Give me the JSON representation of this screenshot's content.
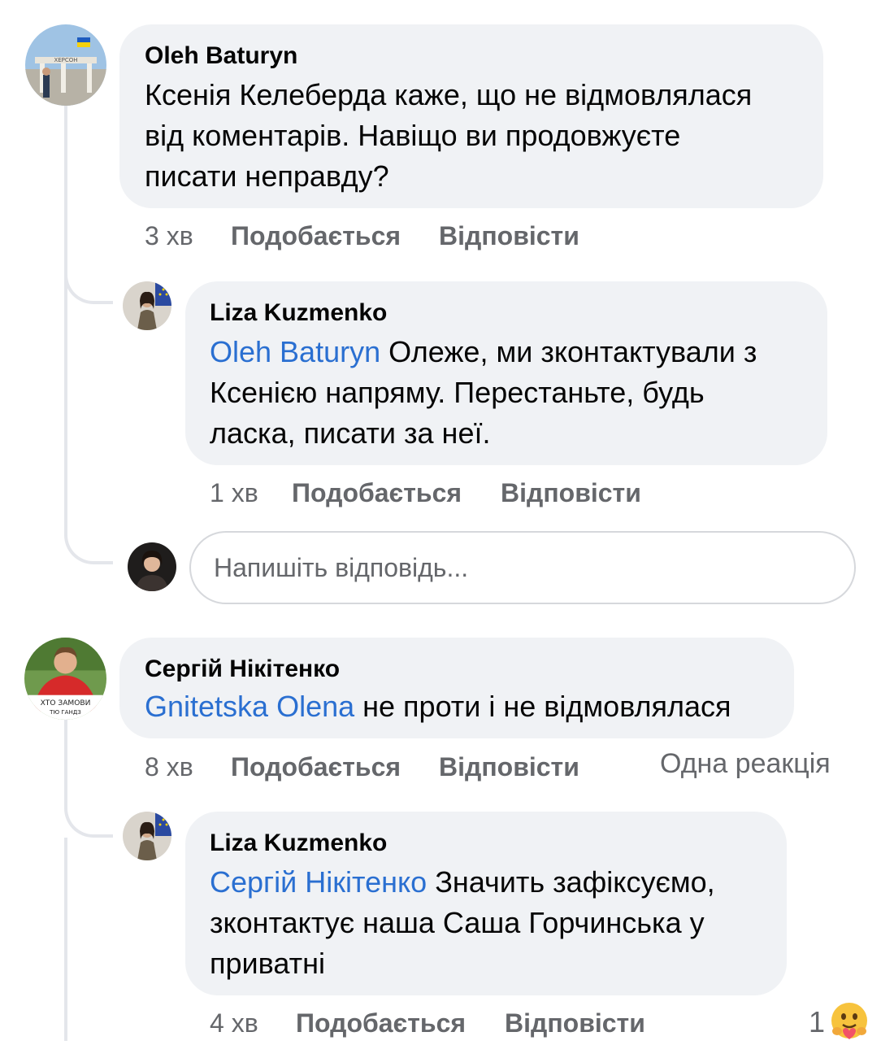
{
  "comments": [
    {
      "author": "Oleh Baturyn",
      "lines": [
        "Ксенія Келеберда каже, що не відмовлялася",
        "від коментарів. Навіщо ви продовжуєте",
        "писати неправду?"
      ],
      "time": "3 хв",
      "like": "Подобається",
      "reply": "Відповісти",
      "avatar_text": "ХЕРСОН",
      "replies": [
        {
          "author": "Liza Kuzmenko",
          "mention": "Oleh Baturyn",
          "lines": [
            " Олеже, ми зконтактували з",
            "Ксенією напряму. Перестаньте, будь",
            "ласка, писати за неї."
          ],
          "time": "1 хв",
          "like": "Подобається",
          "reply": "Відповісти"
        }
      ],
      "reply_input": {
        "placeholder": "Напишіть відповідь..."
      }
    },
    {
      "author": "Сергій Нікітенко",
      "mention": "Gnitetska Olena",
      "text": " не проти і не відмовлялася",
      "time": "8 хв",
      "like": "Подобається",
      "reply": "Відповісти",
      "reactions": "Одна реакція",
      "avatar_text": [
        "ХТО ЗАМОВИ",
        "ТЮ ГАНДЗ"
      ],
      "replies": [
        {
          "author": "Liza Kuzmenko",
          "mention": "Сергій Нікітенко",
          "lines": [
            " Значить зафіксуємо,",
            "зконтактує наша Саша Горчинська у",
            "приватні"
          ],
          "time": "4 хв",
          "like": "Подобається",
          "reply": "Відповісти",
          "reaction_count": "1",
          "reaction_icon": "hug-emoji-icon"
        }
      ]
    }
  ],
  "colors": {
    "bubble": "#f0f2f5",
    "mention": "#2a6fd1",
    "meta": "#65676b"
  }
}
